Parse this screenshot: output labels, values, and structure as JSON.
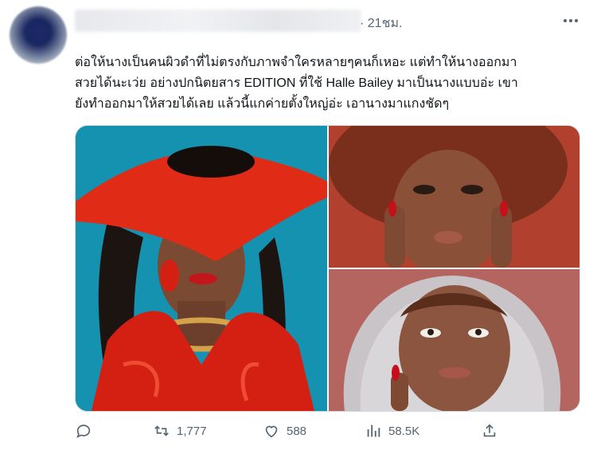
{
  "tweet": {
    "time": "21ชม.",
    "lines": [
      "ต่อให้นางเป็นคนผิวดำที่ไม่ตรงกับภาพจำใครหลายๆคนก็เหอะ แต่ทำให้นางออกมา",
      "สวยได้นะเว่ย อย่างปกนิตยสาร EDITION ที่ใช้ Halle Bailey มาเป็นนางแบบอ่ะ เขา",
      "ยังทำออกมาให้สวยได้เลย แล้วนี้แกค่ายตั้งใหญ่อ่ะ เอานางมาแกงชัดๆ"
    ]
  },
  "actions": {
    "replies": "",
    "retweets": "1,777",
    "likes": "588",
    "views": "58.5K"
  },
  "icons": {
    "more": "more-dots-icon",
    "reply": "reply-icon",
    "retweet": "retweet-icon",
    "like": "heart-icon",
    "views": "views-chart-icon",
    "share": "share-icon"
  },
  "colors": {
    "text": "#0f1419",
    "secondary": "#536471",
    "border": "#cfd9de"
  }
}
